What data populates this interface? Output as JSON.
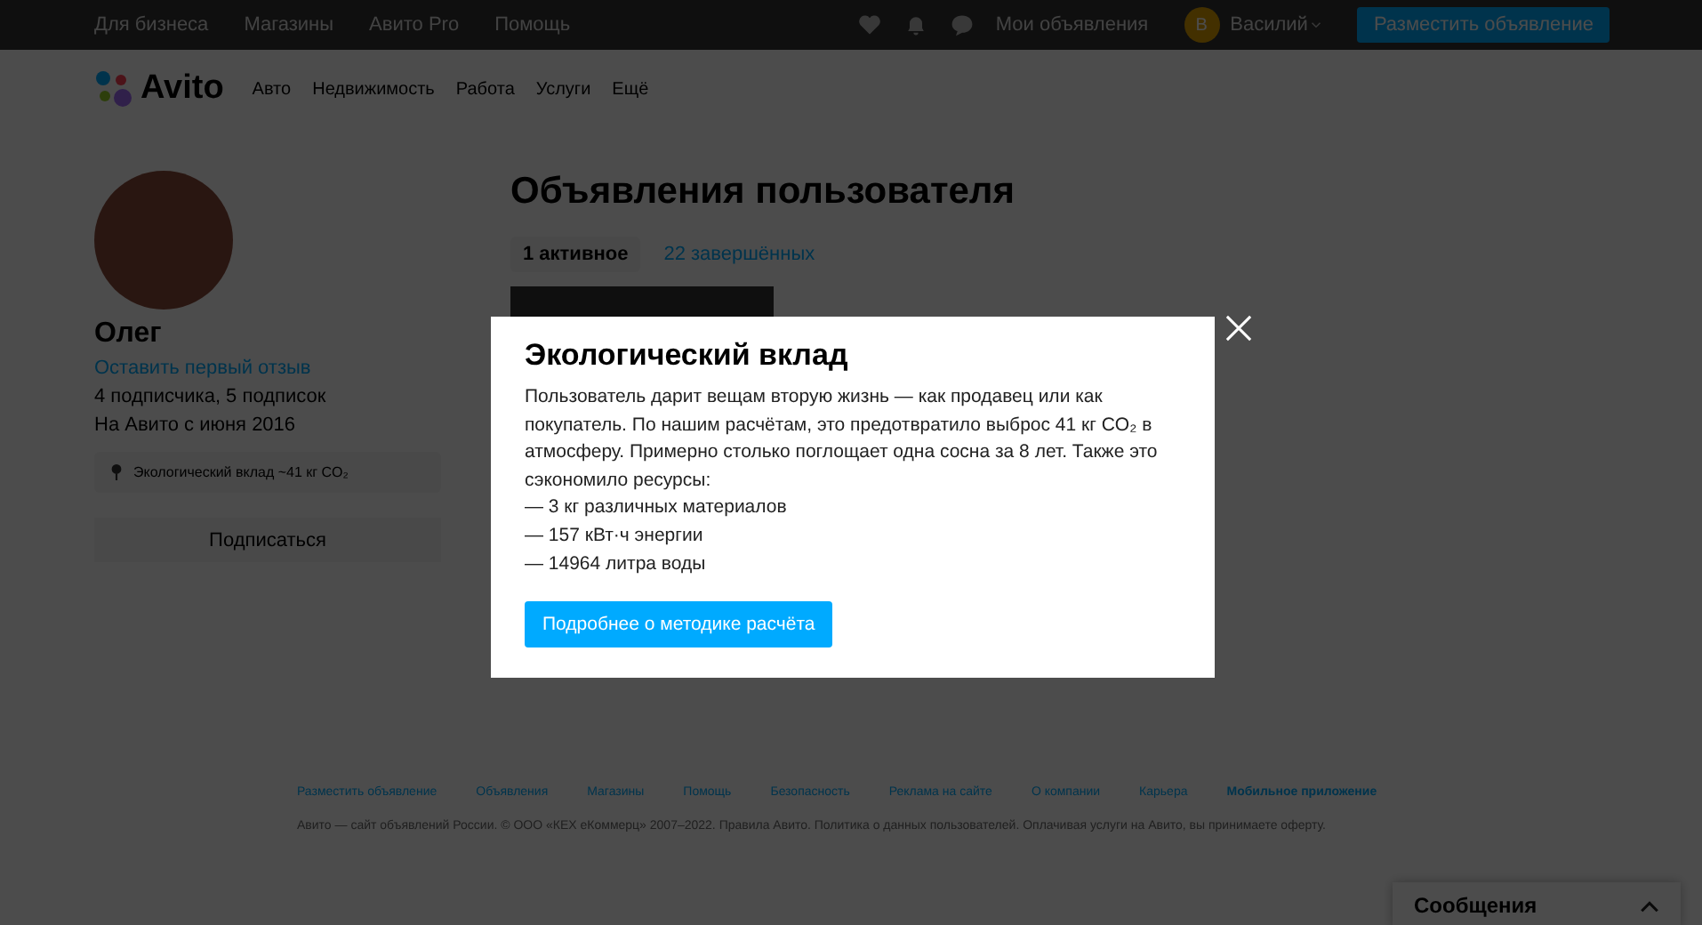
{
  "top_bar": {
    "links": [
      "Для бизнеса",
      "Магазины",
      "Авито Pro",
      "Помощь"
    ],
    "my_ads": "Мои объявления",
    "user_initial": "В",
    "user_name": "Василий",
    "post_button": "Разместить объявление"
  },
  "header": {
    "logo": "Avito",
    "nav": [
      "Авто",
      "Недвижимость",
      "Работа",
      "Услуги",
      "Ещё"
    ]
  },
  "profile": {
    "name": "Олег",
    "review_link": "Оставить первый отзыв",
    "followers": "4 подписчика, 5 подписок",
    "since": "На Авито с июня 2016",
    "eco_badge": "Экологический вклад ~41 кг CO₂",
    "subscribe_button": "Подписаться"
  },
  "listings": {
    "title": "Объявления пользователя",
    "tabs": [
      {
        "label": "1 активное",
        "selected": true
      },
      {
        "label": "22 завершённых",
        "selected": false
      }
    ]
  },
  "modal": {
    "title": "Экологический вклад",
    "text": "Пользователь дарит вещам вторую жизнь — как продавец или как покупатель. По нашим расчётам, это предотвратило выброс 41 кг CO₂ в атмосферу. Примерно столько поглощает одна сосна за 8 лет. Также это сэкономило ресурсы:",
    "items": [
      "— 3 кг различных материалов",
      "— 157 кВт·ч энергии",
      "— 14964 литра воды"
    ],
    "button": "Подробнее о методике расчёта"
  },
  "footer": {
    "links": [
      {
        "label": "Разместить объявление",
        "bold": false
      },
      {
        "label": "Объявления",
        "bold": false
      },
      {
        "label": "Магазины",
        "bold": false
      },
      {
        "label": "Помощь",
        "bold": false
      },
      {
        "label": "Безопасность",
        "bold": false
      },
      {
        "label": "Реклама на сайте",
        "bold": false
      },
      {
        "label": "О компании",
        "bold": false
      },
      {
        "label": "Карьера",
        "bold": false
      },
      {
        "label": "Мобильное приложение",
        "bold": true
      }
    ],
    "copyright": "Авито — сайт объявлений России. © ООО «КЕХ еКоммерц» 2007–2022. Правила Авито. Политика о данных пользователей. Оплачивая услуги на Авито, вы принимаете оферту."
  },
  "messages_panel": {
    "title": "Сообщения"
  }
}
